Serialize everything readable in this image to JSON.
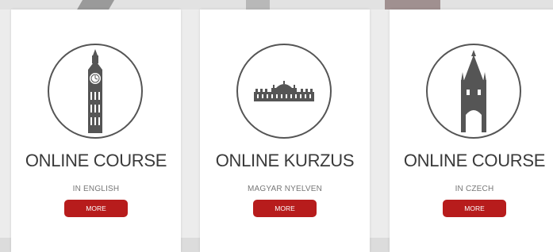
{
  "cards": [
    {
      "title": "ONLINE COURSE",
      "subtitle": "IN ENGLISH",
      "button": "MORE",
      "icon": "big-ben-icon"
    },
    {
      "title": "ONLINE KURZUS",
      "subtitle": "MAGYAR NYELVEN",
      "button": "MORE",
      "icon": "parliament-icon"
    },
    {
      "title": "ONLINE COURSE",
      "subtitle": "IN CZECH",
      "button": "MORE",
      "icon": "prague-tower-icon"
    }
  ],
  "colors": {
    "button_bg": "#b71c1c",
    "icon_stroke": "#555555",
    "title_text": "#3a3a3a",
    "subtitle_text": "#777777"
  }
}
